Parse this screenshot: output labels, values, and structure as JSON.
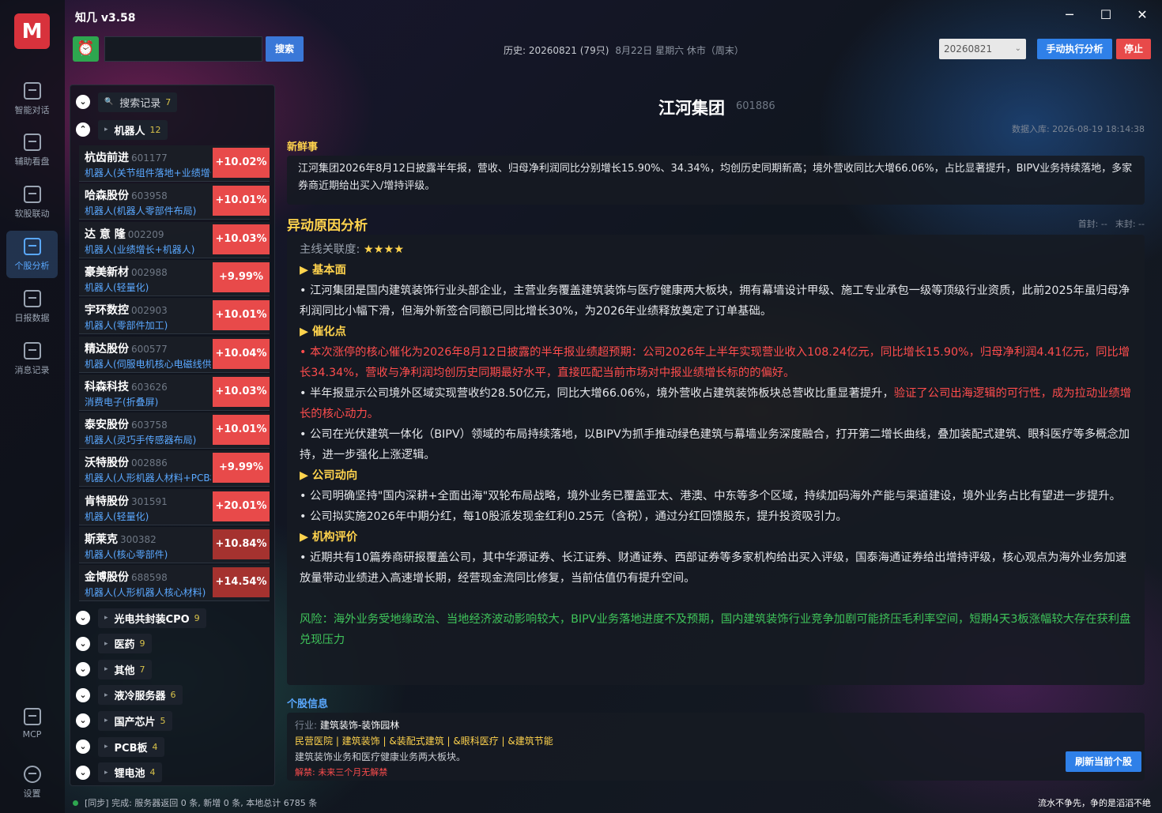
{
  "app": {
    "title": "知几 v3.58",
    "logo_glyph": "M"
  },
  "window": {
    "minimize": "─",
    "maximize": "☐",
    "close": "✕"
  },
  "sidebar": [
    {
      "label": "智能对话",
      "icon": "chart-bar-icon"
    },
    {
      "label": "辅助看盘",
      "icon": "chart-bar-icon"
    },
    {
      "label": "软股联动",
      "icon": "link-icon"
    },
    {
      "label": "个股分析",
      "icon": "clipboard-icon",
      "active": true
    },
    {
      "label": "日报数据",
      "icon": "chart-line-icon"
    },
    {
      "label": "消息记录",
      "icon": "edit-icon"
    },
    {
      "label": "MCP",
      "icon": "plug-icon"
    },
    {
      "label": "设置",
      "icon": "gear-icon"
    }
  ],
  "toolbar": {
    "alarm_glyph": "⏰",
    "search_value": "",
    "search_label": "搜索",
    "history": "历史: 20260821 (79只)",
    "market_date": "8月22日 星期六 休市（周末）",
    "date_select": "20260821",
    "run_label": "手动执行分析",
    "stop_label": "停止"
  },
  "groups": {
    "search_history": {
      "label": "搜索记录",
      "count": "7",
      "icon": "search-icon"
    },
    "robot": {
      "label": "机器人",
      "count": "12"
    },
    "collapsed": [
      {
        "label": "光电共封装CPO",
        "count": "9"
      },
      {
        "label": "医药",
        "count": "9"
      },
      {
        "label": "其他",
        "count": "7"
      },
      {
        "label": "液冷服务器",
        "count": "6"
      },
      {
        "label": "国产芯片",
        "count": "5"
      },
      {
        "label": "PCB板",
        "count": "4"
      },
      {
        "label": "锂电池",
        "count": "4"
      }
    ]
  },
  "stocks": [
    {
      "name": "杭齿前进",
      "code": "601177",
      "tag": "机器人(关节组件落地+业绩增长)",
      "change": "+10.02%"
    },
    {
      "name": "哈森股份",
      "code": "603958",
      "tag": "机器人(机器人零部件布局)",
      "change": "+10.01%"
    },
    {
      "name": "达 意 隆",
      "code": "002209",
      "tag": "机器人(业绩增长+机器人)",
      "change": "+10.03%"
    },
    {
      "name": "豪美新材",
      "code": "002988",
      "tag": "机器人(轻量化)",
      "change": "+9.99%"
    },
    {
      "name": "宇环数控",
      "code": "002903",
      "tag": "机器人(零部件加工)",
      "change": "+10.01%"
    },
    {
      "name": "精达股份",
      "code": "600577",
      "tag": "机器人(伺服电机核心电磁线供应)",
      "change": "+10.04%"
    },
    {
      "name": "科森科技",
      "code": "603626",
      "tag": "消费电子(折叠屏)",
      "change": "+10.03%"
    },
    {
      "name": "泰安股份",
      "code": "603758",
      "tag": "机器人(灵巧手传感器布局)",
      "change": "+10.01%"
    },
    {
      "name": "沃特股份",
      "code": "002886",
      "tag": "机器人(人形机器人材料+PCB材料)",
      "change": "+9.99%"
    },
    {
      "name": "肯特股份",
      "code": "301591",
      "tag": "机器人(轻量化)",
      "change": "+20.01%"
    },
    {
      "name": "斯莱克",
      "code": "300382",
      "tag": "机器人(核心零部件)",
      "change": "+10.84%",
      "dark": true
    },
    {
      "name": "金博股份",
      "code": "688598",
      "tag": "机器人(人形机器人核心材料)",
      "change": "+14.54%",
      "dark": true
    }
  ],
  "detail": {
    "name": "江河集团",
    "code": "601886",
    "db_time": "数据入库: 2026-08-19 18:14:38",
    "fresh_title": "新鲜事",
    "fresh_text": "江河集团2026年8月12日披露半年报，营收、归母净利润同比分别增长15.90%、34.34%，均创历史同期新高；境外营收同比大增66.06%，占比显著提升，BIPV业务持续落地，多家券商近期给出买入/增持评级。",
    "abnormal_title": "异动原因分析",
    "first_seal": "首封: --",
    "last_seal": "末封: --",
    "relevance_label": "主线关联度: ",
    "relevance_stars": "★★★★",
    "h_basic": "▶ 基本面",
    "basic": "• 江河集团是国内建筑装饰行业头部企业，主营业务覆盖建筑装饰与医疗健康两大板块，拥有幕墙设计甲级、施工专业承包一级等顶级行业资质，此前2025年虽归母净利润同比小幅下滑，但海外新签合同额已同比增长30%，为2026年业绩释放奠定了订单基础。",
    "h_catalyst": "▶ 催化点",
    "catalyst1": "• 本次涨停的核心催化为2026年8月12日披露的半年报业绩超预期：公司2026年上半年实现营业收入108.24亿元，同比增长15.90%，归母净利润4.41亿元，同比增长34.34%，营收与净利润均创历史同期最好水平，直接匹配当前市场对中报业绩增长标的的偏好。",
    "catalyst2a": "• 半年报显示公司境外区域实现营收约28.50亿元，同比大增66.06%，境外营收占建筑装饰板块总营收比重显著提升，",
    "catalyst2b": "验证了公司出海逻辑的可行性，成为拉动业绩增长的核心动力。",
    "catalyst3": "• 公司在光伏建筑一体化（BIPV）领域的布局持续落地，以BIPV为抓手推动绿色建筑与幕墙业务深度融合，打开第二增长曲线，叠加装配式建筑、眼科医疗等多概念加持，进一步强化上涨逻辑。",
    "h_direction": "▶ 公司动向",
    "direction1": "• 公司明确坚持\"国内深耕+全面出海\"双轮布局战略，境外业务已覆盖亚太、港澳、中东等多个区域，持续加码海外产能与渠道建设，境外业务占比有望进一步提升。",
    "direction2": "• 公司拟实施2026年中期分红，每10股派发现金红利0.25元（含税），通过分红回馈股东，提升投资吸引力。",
    "h_rating": "▶ 机构评价",
    "rating": "• 近期共有10篇券商研报覆盖公司，其中华源证券、长江证券、财通证券、西部证券等多家机构给出买入评级，国泰海通证券给出增持评级，核心观点为海外业务加速放量带动业绩进入高速增长期，经营现金流同比修复，当前估值仍有提升空间。",
    "risk": "风险：海外业务受地缘政治、当地经济波动影响较大，BIPV业务落地进度不及预期，国内建筑装饰行业竞争加剧可能挤压毛利率空间，短期4天3板涨幅较大存在获利盘兑现压力",
    "info_title": "个股信息",
    "industry_label": "行业: ",
    "industry": "建筑装饰-装饰园林",
    "concepts": "民营医院 | 建筑装饰 | &装配式建筑 | &眼科医疗 | &建筑节能",
    "business": "建筑装饰业务和医疗健康业务两大板块。",
    "unlock": "解禁: 未来三个月无解禁",
    "refresh_label": "刷新当前个股"
  },
  "status": {
    "text": "[同步] 完成: 服务器返回 0 条, 新增 0 条, 本地总计 6785 条",
    "slogan": "流水不争先，争的是滔滔不绝"
  },
  "colors": {
    "up": "#e84a4a",
    "accent": "#2f80e8",
    "highlight": "#ffd34d",
    "risk": "#3fc45a"
  }
}
